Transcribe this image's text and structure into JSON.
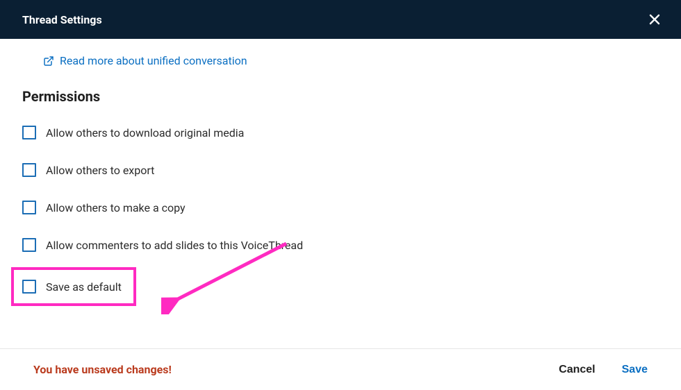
{
  "header": {
    "title": "Thread Settings"
  },
  "link": {
    "label": "Read more about unified conversation"
  },
  "permissions": {
    "title": "Permissions",
    "options": [
      "Allow others to download original media",
      "Allow others to export",
      "Allow others to make a copy",
      "Allow commenters to add slides to this VoiceThread"
    ]
  },
  "save_default": {
    "label": "Save as default"
  },
  "footer": {
    "unsaved": "You have unsaved changes!",
    "cancel": "Cancel",
    "save": "Save"
  }
}
